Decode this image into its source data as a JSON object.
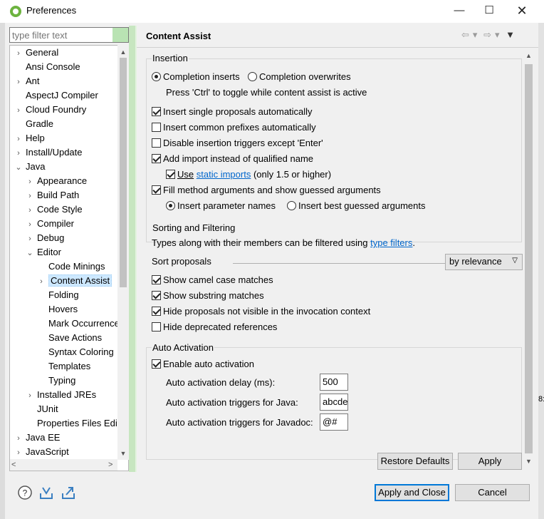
{
  "window": {
    "title": "Preferences",
    "minimize": "—",
    "maximize": "☐",
    "close": "✕"
  },
  "edge_text": {
    "right": "8:"
  },
  "filter": {
    "placeholder": "type filter text"
  },
  "tree": {
    "items": [
      {
        "label": "General",
        "twisty": ">",
        "level": 0
      },
      {
        "label": "Ansi Console",
        "twisty": "",
        "level": 0
      },
      {
        "label": "Ant",
        "twisty": ">",
        "level": 0
      },
      {
        "label": "AspectJ Compiler",
        "twisty": "",
        "level": 0
      },
      {
        "label": "Cloud Foundry",
        "twisty": ">",
        "level": 0
      },
      {
        "label": "Gradle",
        "twisty": "",
        "level": 0
      },
      {
        "label": "Help",
        "twisty": ">",
        "level": 0
      },
      {
        "label": "Install/Update",
        "twisty": ">",
        "level": 0
      },
      {
        "label": "Java",
        "twisty": "v",
        "level": 0
      },
      {
        "label": "Appearance",
        "twisty": ">",
        "level": 1
      },
      {
        "label": "Build Path",
        "twisty": ">",
        "level": 1
      },
      {
        "label": "Code Style",
        "twisty": ">",
        "level": 1
      },
      {
        "label": "Compiler",
        "twisty": ">",
        "level": 1
      },
      {
        "label": "Debug",
        "twisty": ">",
        "level": 1
      },
      {
        "label": "Editor",
        "twisty": "v",
        "level": 1
      },
      {
        "label": "Code Minings",
        "twisty": "",
        "level": 2
      },
      {
        "label": "Content Assist",
        "twisty": ">",
        "level": 2,
        "selected": true
      },
      {
        "label": "Folding",
        "twisty": "",
        "level": 2
      },
      {
        "label": "Hovers",
        "twisty": "",
        "level": 2
      },
      {
        "label": "Mark Occurrences",
        "twisty": "",
        "level": 2
      },
      {
        "label": "Save Actions",
        "twisty": "",
        "level": 2
      },
      {
        "label": "Syntax Coloring",
        "twisty": "",
        "level": 2
      },
      {
        "label": "Templates",
        "twisty": "",
        "level": 2
      },
      {
        "label": "Typing",
        "twisty": "",
        "level": 2
      },
      {
        "label": "Installed JREs",
        "twisty": ">",
        "level": 1
      },
      {
        "label": "JUnit",
        "twisty": "",
        "level": 1
      },
      {
        "label": "Properties Files Editor",
        "twisty": "",
        "level": 1
      },
      {
        "label": "Java EE",
        "twisty": ">",
        "level": 0
      },
      {
        "label": "JavaScript",
        "twisty": ">",
        "level": 0
      }
    ]
  },
  "page": {
    "title": "Content Assist",
    "insertion": {
      "group_label": "Insertion",
      "radio_inserts": "Completion inserts",
      "radio_overwrites": "Completion overwrites",
      "toggle_hint": "Press 'Ctrl' to toggle while content assist is active",
      "cb_single": "Insert single proposals automatically",
      "cb_prefixes": "Insert common prefixes automatically",
      "cb_disable_triggers": "Disable insertion triggers except 'Enter'",
      "cb_add_import": "Add import instead of qualified name",
      "cb_use": "Use",
      "static_imports_link": "static imports",
      "static_imports_suffix": "(only 1.5 or higher)",
      "cb_fill_args": "Fill method arguments and show guessed arguments",
      "radio_param_names": "Insert parameter names",
      "radio_best_guessed": "Insert best guessed arguments"
    },
    "sorting": {
      "group_label": "Sorting and Filtering",
      "types_text": "Types along with their members can be filtered using",
      "type_filters_link": "type filters",
      "period": ".",
      "sort_label": "Sort proposals",
      "sort_value": "by relevance",
      "cb_camel": "Show camel case matches",
      "cb_substring": "Show substring matches",
      "cb_hide_not_visible": "Hide proposals not visible in the invocation context",
      "cb_hide_deprecated": "Hide deprecated references"
    },
    "auto_activation": {
      "group_label": "Auto Activation",
      "cb_enable": "Enable auto activation",
      "delay_label": "Auto activation delay (ms):",
      "delay_value": "500",
      "java_triggers_label": "Auto activation triggers for Java:",
      "java_triggers_value": "abcdefghijklmnopqrstuvwxyz",
      "javadoc_triggers_label": "Auto activation triggers for Javadoc:",
      "javadoc_triggers_value": "@#"
    },
    "restore_defaults": "Restore Defaults",
    "apply": "Apply"
  },
  "footer": {
    "apply_and_close": "Apply and Close",
    "cancel": "Cancel"
  },
  "icons": [
    "spring-icon",
    "help-icon",
    "import-icon",
    "export-icon",
    "back-icon",
    "forward-icon",
    "view-menu-icon"
  ]
}
